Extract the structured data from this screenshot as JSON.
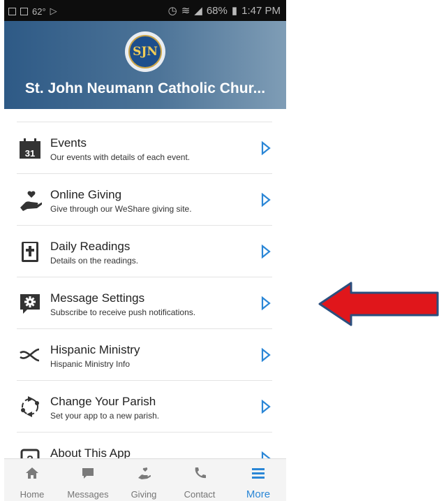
{
  "status_bar": {
    "temperature": "62°",
    "battery": "68%",
    "time": "1:47 PM"
  },
  "header": {
    "logo_text": "SJN",
    "title": "St. John Neumann Catholic Chur..."
  },
  "list": [
    {
      "icon": "calendar-icon",
      "title": "Events",
      "subtitle": "Our events with details of each event.",
      "calendar_day": "31"
    },
    {
      "icon": "giving-hand-icon",
      "title": "Online Giving",
      "subtitle": "Give through our WeShare giving site."
    },
    {
      "icon": "bible-icon",
      "title": "Daily Readings",
      "subtitle": "Details on the readings."
    },
    {
      "icon": "message-settings-icon",
      "title": "Message Settings",
      "subtitle": "Subscribe to receive push notifications."
    },
    {
      "icon": "fish-icon",
      "title": "Hispanic Ministry",
      "subtitle": "Hispanic Ministry Info"
    },
    {
      "icon": "change-parish-icon",
      "title": "Change Your Parish",
      "subtitle": "Set your app to a new parish."
    },
    {
      "icon": "about-icon",
      "title": "About This App",
      "subtitle": ""
    }
  ],
  "tabs": [
    {
      "icon": "home-icon",
      "label": "Home"
    },
    {
      "icon": "messages-icon",
      "label": "Messages"
    },
    {
      "icon": "giving-icon",
      "label": "Giving"
    },
    {
      "icon": "phone-icon",
      "label": "Contact"
    },
    {
      "icon": "menu-icon",
      "label": "More"
    }
  ],
  "colors": {
    "accent": "#2a86d6",
    "arrow": "#e0161b",
    "arrow_outline": "#2b4f7e",
    "header_start": "#2e5a86",
    "header_end": "#7f9db6"
  }
}
